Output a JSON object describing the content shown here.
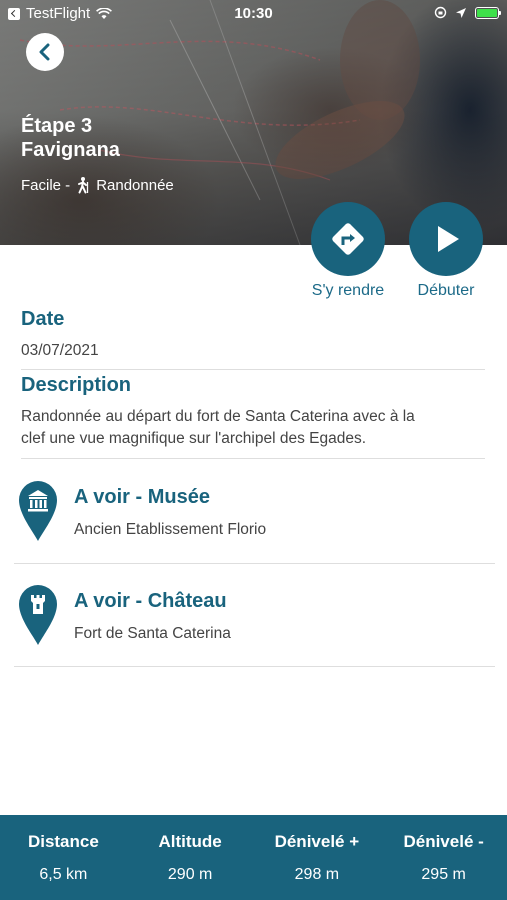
{
  "status_bar": {
    "app": "TestFlight",
    "time": "10:30"
  },
  "hero": {
    "title_line1": "Étape 3",
    "title_line2": "Favignana",
    "difficulty": "Facile -",
    "activity": "Randonnée"
  },
  "actions": {
    "directions_label": "S'y rendre",
    "start_label": "Débuter"
  },
  "date": {
    "heading": "Date",
    "value": "03/07/2021"
  },
  "description": {
    "heading": "Description",
    "line1": "Randonnée au départ du fort de Santa Caterina avec à la",
    "line2": "clef une vue magnifique sur l'archipel des Egades."
  },
  "points_of_interest": [
    {
      "title": "A voir - Musée",
      "subtitle": "Ancien Etablissement Florio",
      "icon": "museum-icon"
    },
    {
      "title": "A voir - Château",
      "subtitle": "Fort de Santa Caterina",
      "icon": "castle-icon"
    }
  ],
  "stats": [
    {
      "label": "Distance",
      "value": "6,5 km"
    },
    {
      "label": "Altitude",
      "value": "290 m"
    },
    {
      "label": "Dénivelé +",
      "value": "298 m"
    },
    {
      "label": "Dénivelé -",
      "value": "295 m"
    }
  ],
  "colors": {
    "accent": "#19637d",
    "battery": "#3ee04a"
  }
}
